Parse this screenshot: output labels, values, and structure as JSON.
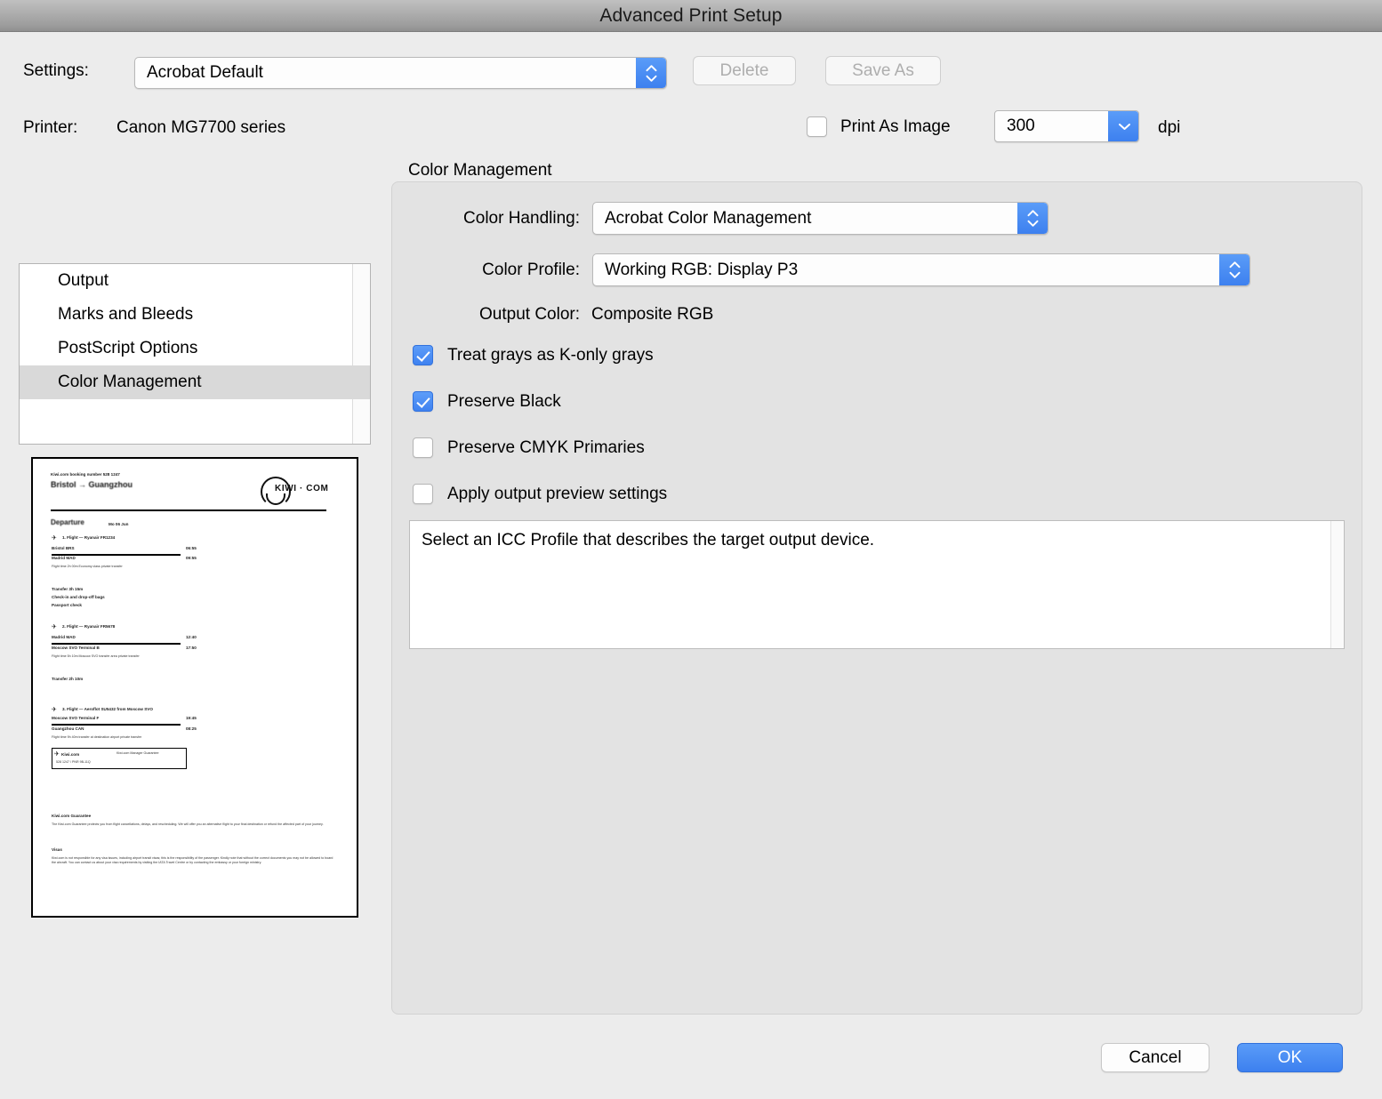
{
  "window": {
    "title": "Advanced Print Setup"
  },
  "settings": {
    "label": "Settings:",
    "value": "Acrobat Default",
    "delete_label": "Delete",
    "save_as_label": "Save As"
  },
  "printer": {
    "label": "Printer:",
    "value": "Canon MG7700 series"
  },
  "print_as_image": {
    "label": "Print As Image",
    "checked": false,
    "dpi_value": "300",
    "dpi_unit": "dpi"
  },
  "options_list": {
    "items": [
      {
        "label": "Output",
        "selected": false
      },
      {
        "label": "Marks and Bleeds",
        "selected": false
      },
      {
        "label": "PostScript Options",
        "selected": false
      },
      {
        "label": "Color Management",
        "selected": true
      }
    ]
  },
  "preview": {
    "booking_ref": "Kiwi.com booking number 528 1247",
    "route_title": "Bristol → Guangzhou",
    "departure_heading": "Departure",
    "departure_date": "Mo 06 Jun",
    "logo_text": "KIWI · COM",
    "segments": [
      {
        "flight": "1. Flight — Ryanair FR1234",
        "from": "Bristol BRS",
        "from_time": "06:55",
        "to": "Madrid MAD",
        "to_time": "09:55",
        "detail": "Flight time 2h 00m      Economy class      private transfer"
      },
      {
        "transfer": "Transfer 3h 15m",
        "note_1": "Check-in and drop-off bags",
        "note_2": "Passport check"
      },
      {
        "flight": "2. Flight — Ryanair FR5678",
        "from": "Madrid MAD",
        "from_time": "12:40",
        "to": "Moscow SVO Terminal B",
        "to_time": "17:50",
        "detail": "Flight time 5h 10m      Moscow SVO transfer area      private transfer"
      },
      {
        "transfer": "Transfer 2h 10m"
      },
      {
        "flight": "3. Flight — Aeroflot SU5432 from Moscow SVO",
        "from": "Moscow SVO Terminal F",
        "from_time": "19:45",
        "to": "Guangzhou CAN",
        "to_time": "08:25",
        "detail": "Flight time 9h 40m      transfer at destination airport      private transfer"
      }
    ],
    "footer_box": {
      "line_1": "Kiwi.com",
      "line_2": "528 1247  /  PNR 9B-11Q",
      "line_3": "Kiwi.com Manager Guarantee"
    },
    "notes": [
      {
        "heading": "Kiwi.com Guarantee",
        "body": "The Kiwi.com Guarantee protects you from flight cancellations, delays, and rescheduling. We will offer you an alternative flight to your final destination or refund the affected part of your journey."
      },
      {
        "heading": "Visas",
        "body": "Kiwi.com is not responsible for any visa issues, including airport transit visas; this is the responsibility of the passenger. Kindly note that without the correct documents you may not be allowed to board the aircraft. You can contact us about your visa requirements by visiting the IATA Travel Centre or by contacting the embassy or your foreign ministry."
      }
    ]
  },
  "color_management": {
    "group_title": "Color Management",
    "color_handling": {
      "label": "Color Handling:",
      "value": "Acrobat Color Management"
    },
    "color_profile": {
      "label": "Color Profile:",
      "value": "Working RGB: Display P3"
    },
    "output_color": {
      "label": "Output Color:",
      "value": "Composite RGB"
    },
    "checkboxes": [
      {
        "label": "Treat grays as K-only grays",
        "checked": true
      },
      {
        "label": "Preserve Black",
        "checked": true
      },
      {
        "label": "Preserve CMYK Primaries",
        "checked": false
      },
      {
        "label": "Apply output preview settings",
        "checked": false
      }
    ],
    "description": "Select an ICC Profile that describes the target output device."
  },
  "footer": {
    "cancel_label": "Cancel",
    "ok_label": "OK"
  },
  "colors": {
    "accent_blue": "#3d80ef",
    "window_bg": "#ececec",
    "panel_bg": "#e3e3e3",
    "titlebar_top": "#c0c0c0",
    "titlebar_bottom": "#8e8e8e",
    "selection_gray": "#d9d9d9"
  }
}
